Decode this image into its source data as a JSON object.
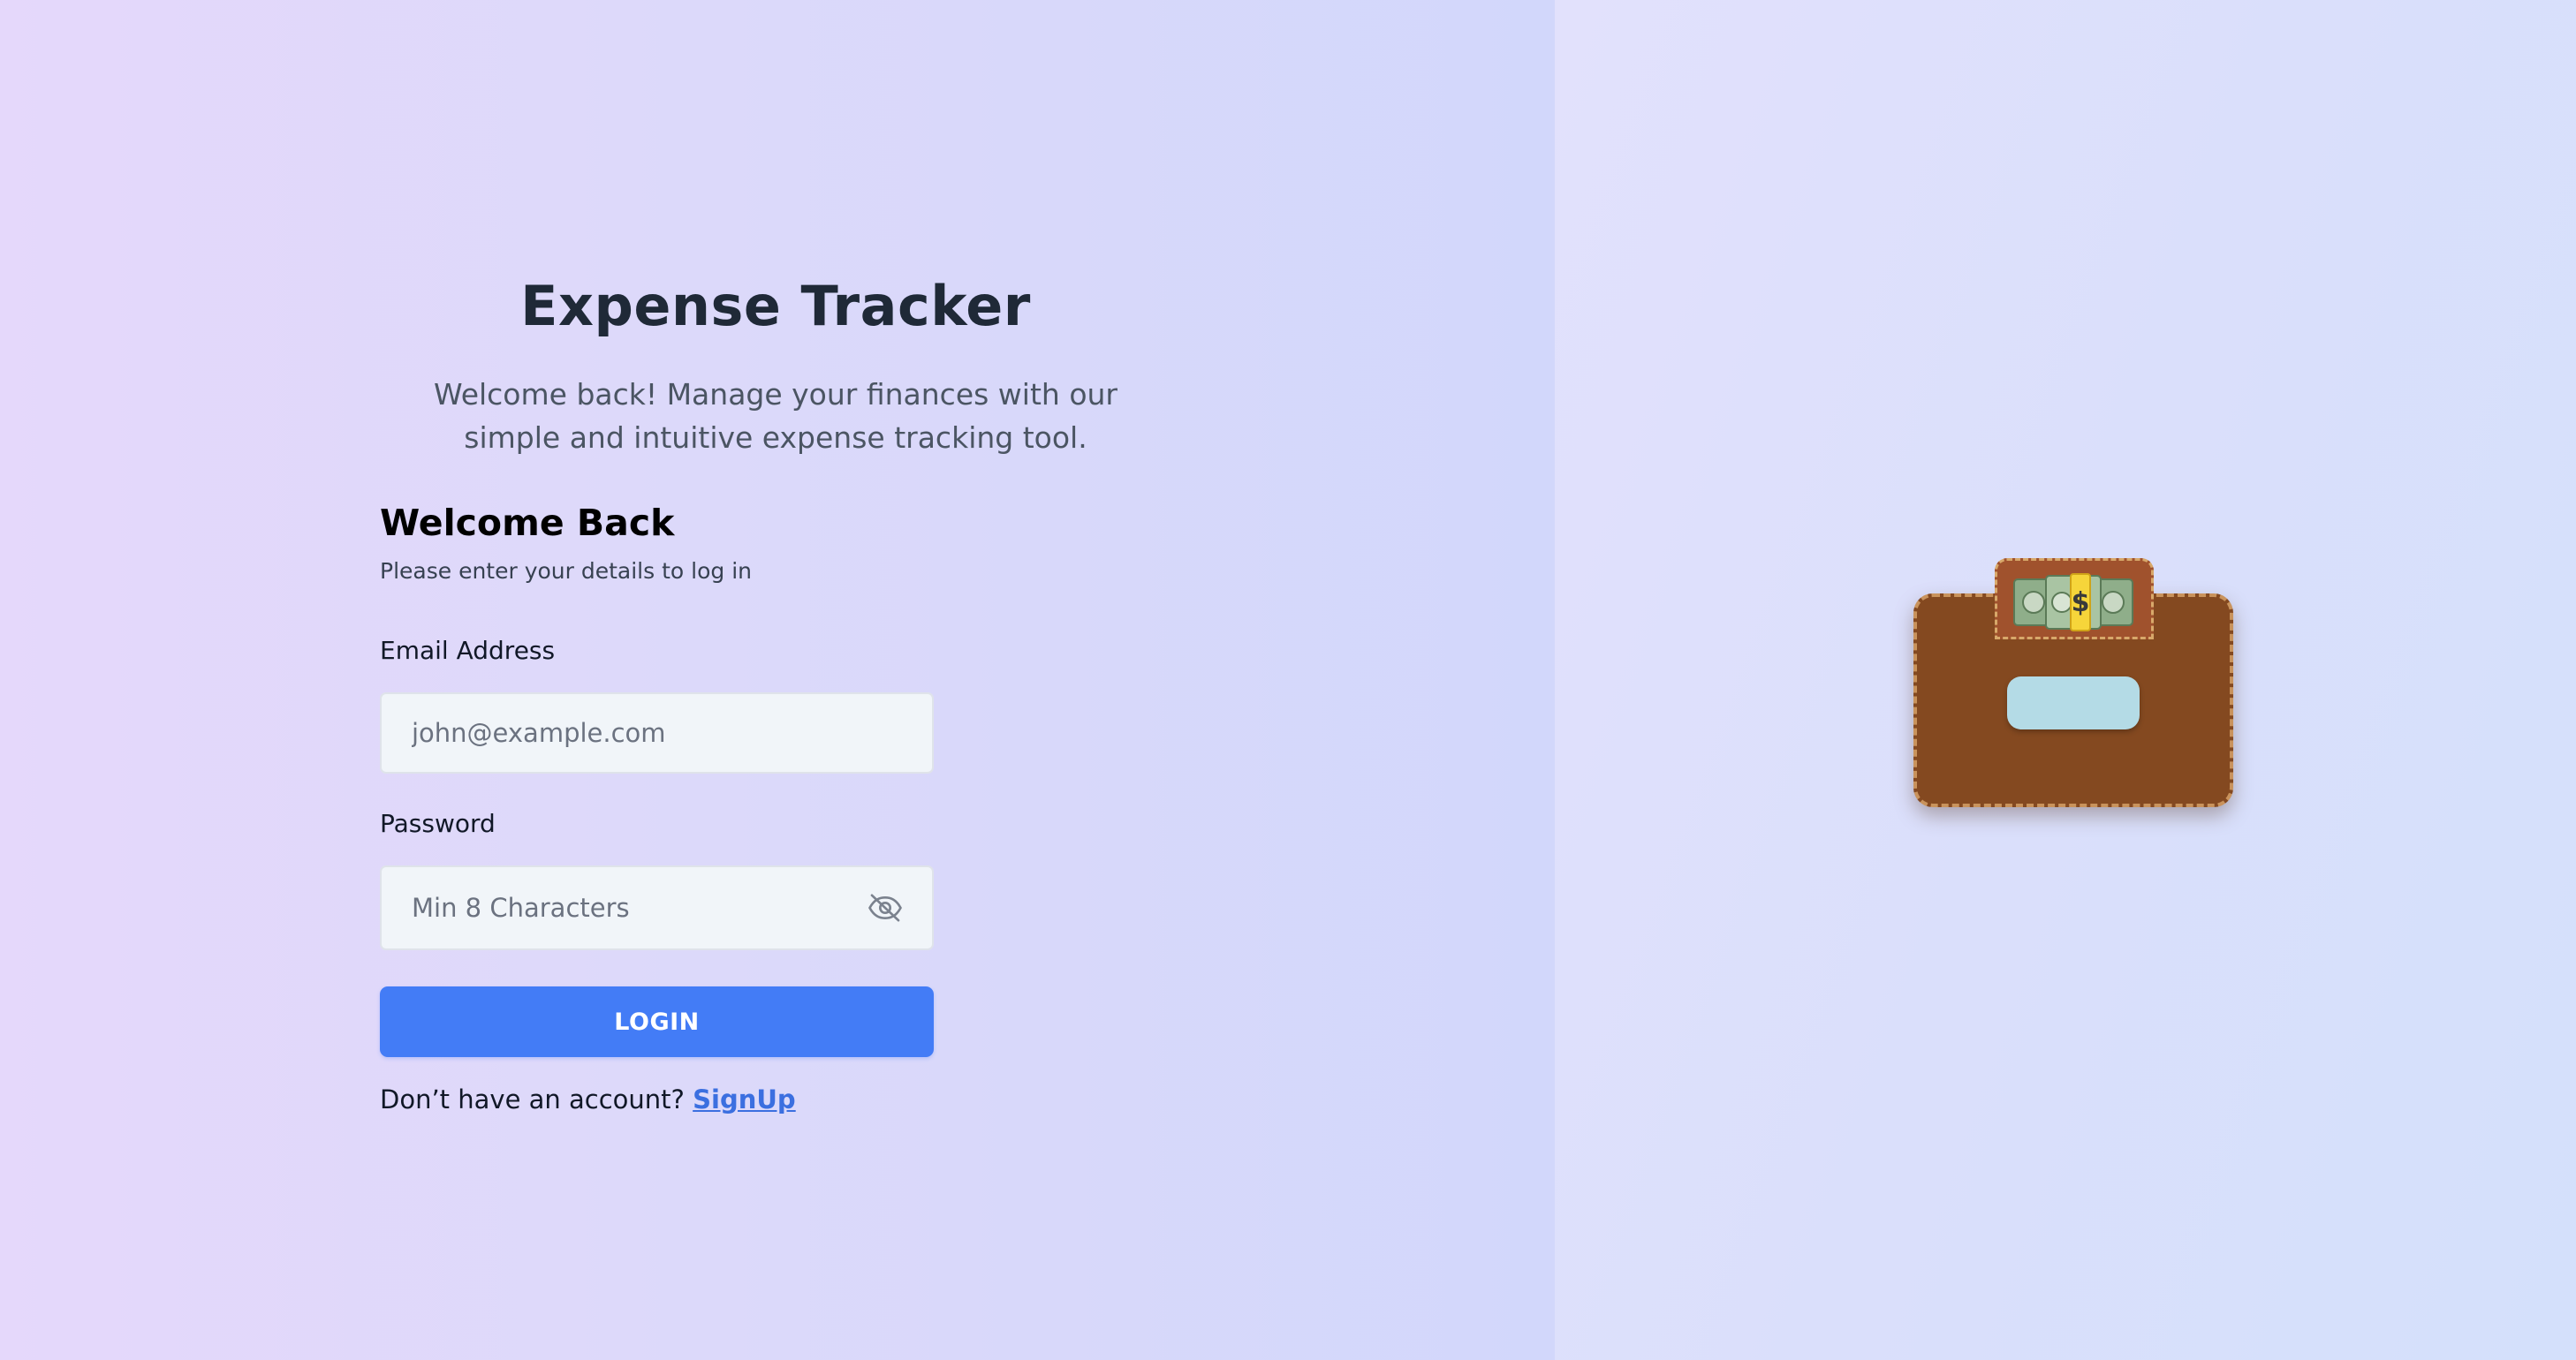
{
  "header": {
    "app_title": "Expense Tracker",
    "app_subtitle": "Welcome back! Manage your finances with our simple and intuitive expense tracking tool."
  },
  "login_form": {
    "heading": "Welcome Back",
    "subheading": "Please enter your details to log in",
    "email": {
      "label": "Email Address",
      "placeholder": "john@example.com",
      "value": ""
    },
    "password": {
      "label": "Password",
      "placeholder": "Min 8 Characters",
      "value": "",
      "visibility_icon": "eye-off-icon"
    },
    "login_button_label": "LOGIN",
    "signup_prompt": "Don’t have an account?",
    "signup_link_label": "SignUp"
  },
  "illustration": {
    "icon": "wallet-icon",
    "money_icon": "money-bag-icon"
  },
  "colors": {
    "primary": "#437cf6",
    "link": "#3b6fe0",
    "wallet_body": "#844920",
    "wallet_pocket": "#a0522d",
    "wallet_clasp": "#b4dbe6",
    "title_text": "#1f2937"
  }
}
